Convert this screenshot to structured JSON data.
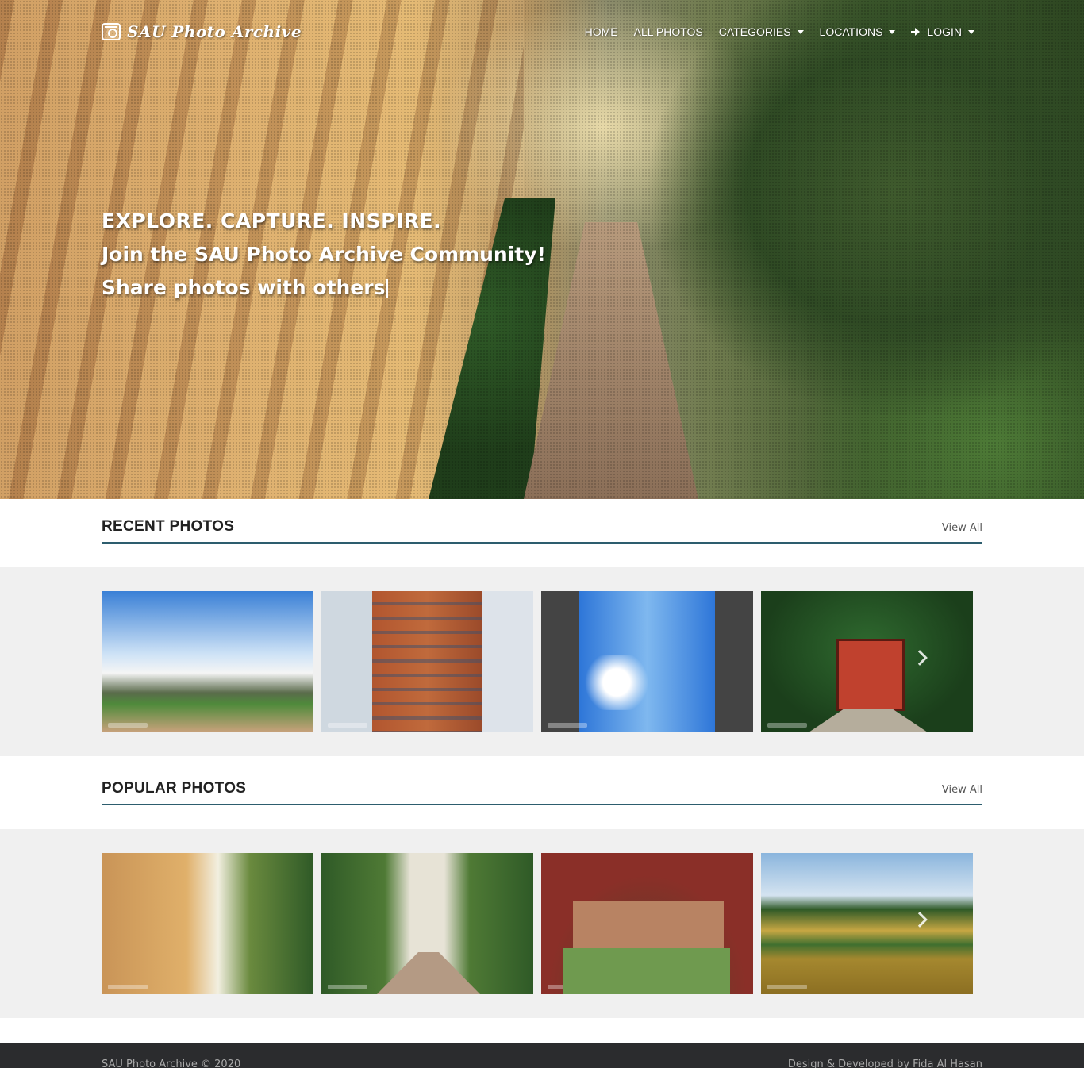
{
  "brand": {
    "name": "SAU Photo Archive"
  },
  "nav": {
    "items": [
      {
        "label": "HOME"
      },
      {
        "label": "ALL PHOTOS"
      },
      {
        "label": "CATEGORIES"
      },
      {
        "label": "LOCATIONS"
      },
      {
        "label": "LOGIN"
      }
    ]
  },
  "hero": {
    "line1": "EXPLORE. CAPTURE. INSPIRE.",
    "line2": "Join the SAU Photo Archive Community!",
    "line3": "Share photos with others"
  },
  "recent": {
    "title": "RECENT PHOTOS",
    "view_all": "View All"
  },
  "popular": {
    "title": "POPULAR PHOTOS",
    "view_all": "View All"
  },
  "footer": {
    "left": "SAU Photo Archive © 2020",
    "right": "Design & Developed by Fida Al Hasan"
  },
  "colors": {
    "section_rule": "#2d5d6e",
    "band": "#f0f0f0",
    "footer_bg": "#2b2c2e"
  }
}
